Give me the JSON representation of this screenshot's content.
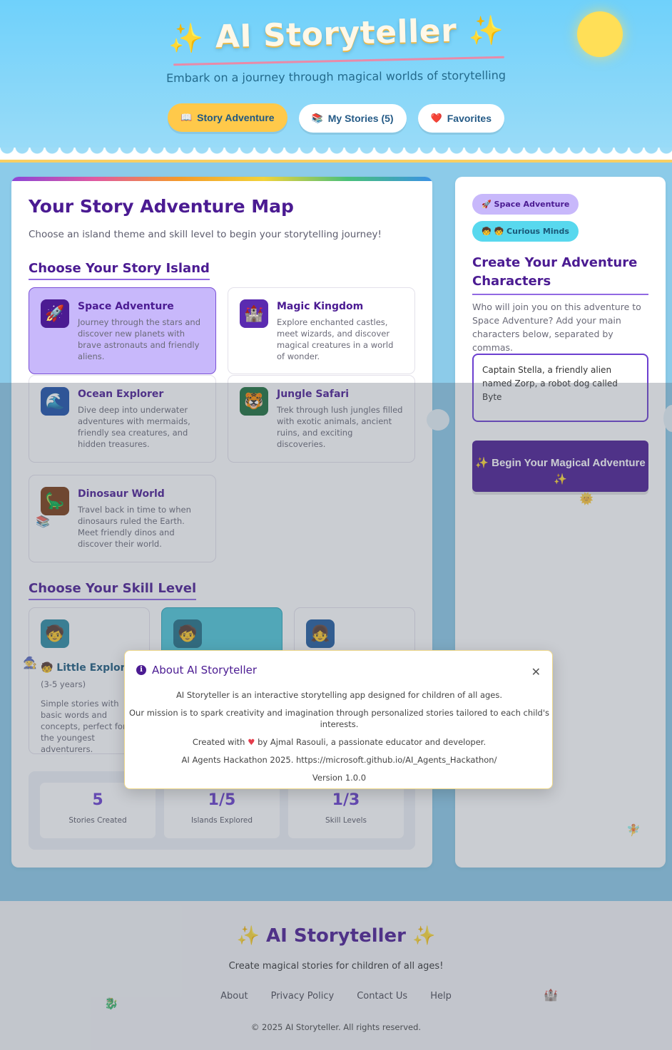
{
  "header": {
    "title": "AI Storyteller",
    "tagline": "Embark on a journey through magical worlds of storytelling",
    "nav": [
      {
        "icon": "📖",
        "label": "Story Adventure",
        "active": true
      },
      {
        "icon": "📚",
        "label": "My Stories (5)",
        "active": false
      },
      {
        "icon": "❤️",
        "label": "Favorites",
        "active": false
      }
    ]
  },
  "map": {
    "title": "Your Story Adventure Map",
    "subtitle": "Choose an island theme and skill level to begin your storytelling journey!",
    "island_heading": "Choose Your Story Island",
    "islands": [
      {
        "icon": "🚀",
        "title": "Space Adventure",
        "desc": "Journey through the stars and discover new planets with brave astronauts and friendly aliens.",
        "selected": true
      },
      {
        "icon": "🏰",
        "title": "Magic Kingdom",
        "desc": "Explore enchanted castles, meet wizards, and discover magical creatures in a world of wonder.",
        "selected": false
      },
      {
        "icon": "🌊",
        "title": "Ocean Explorer",
        "desc": "Dive deep into underwater adventures with mermaids, friendly sea creatures, and hidden treasures.",
        "selected": false
      },
      {
        "icon": "🐯",
        "title": "Jungle Safari",
        "desc": "Trek through lush jungles filled with exotic animals, ancient ruins, and exciting discoveries.",
        "selected": false
      },
      {
        "icon": "🦕",
        "title": "Dinosaur World",
        "desc": "Travel back in time to when dinosaurs ruled the Earth. Meet friendly dinos and discover their world.",
        "selected": false
      }
    ],
    "skill_heading": "Choose Your Skill Level",
    "skills": [
      {
        "icon": "🧒",
        "title": "🧒 Little Explorers",
        "age": "(3-5 years)",
        "desc": "Simple stories with basic words and concepts, perfect for the youngest adventurers.",
        "selected": false
      },
      {
        "icon": "🧒",
        "title": "",
        "age": "",
        "desc": "",
        "selected": true
      },
      {
        "icon": "👧",
        "title": "",
        "age": "",
        "desc": "",
        "selected": false
      }
    ],
    "stats": [
      {
        "value": "5",
        "label": "Stories Created"
      },
      {
        "value": "1/5",
        "label": "Islands Explored"
      },
      {
        "value": "1/3",
        "label": "Skill Levels"
      }
    ]
  },
  "side": {
    "tag_island": "🚀 Space Adventure",
    "tag_level": "🧒 🧒 Curious Minds",
    "heading": "Create Your Adventure Characters",
    "desc": "Who will join you on this adventure to Space Adventure? Add your main characters below, separated by commas.",
    "characters_value": "Captain Stella, a friendly alien named Zorp, a robot dog called Byte",
    "begin_label": "✨ Begin Your Magical Adventure ✨"
  },
  "modal": {
    "title": "About AI Storyteller",
    "lines": [
      "AI Storyteller is an interactive storytelling app designed for children of all ages.",
      "Our mission is to spark creativity and imagination through personalized stories tailored to each child's interests.",
      "AI Agents Hackathon 2025. https://microsoft.github.io/AI_Agents_Hackathon/",
      "Version 1.0.0"
    ],
    "created_prefix": "Created with",
    "created_suffix": "by Ajmal Rasouli, a passionate educator and developer."
  },
  "footer": {
    "title": "AI Storyteller",
    "tagline": "Create magical stories for children of all ages!",
    "links": [
      "About",
      "Privacy Policy",
      "Contact Us",
      "Help"
    ],
    "copyright": "© 2025 AI Storyteller. All rights reserved."
  },
  "colors": {
    "primary": "#4b1b92",
    "accent_yellow": "#ffc94a",
    "selected_island": "#c8b8fb",
    "selected_skill": "#4dc7d9"
  }
}
